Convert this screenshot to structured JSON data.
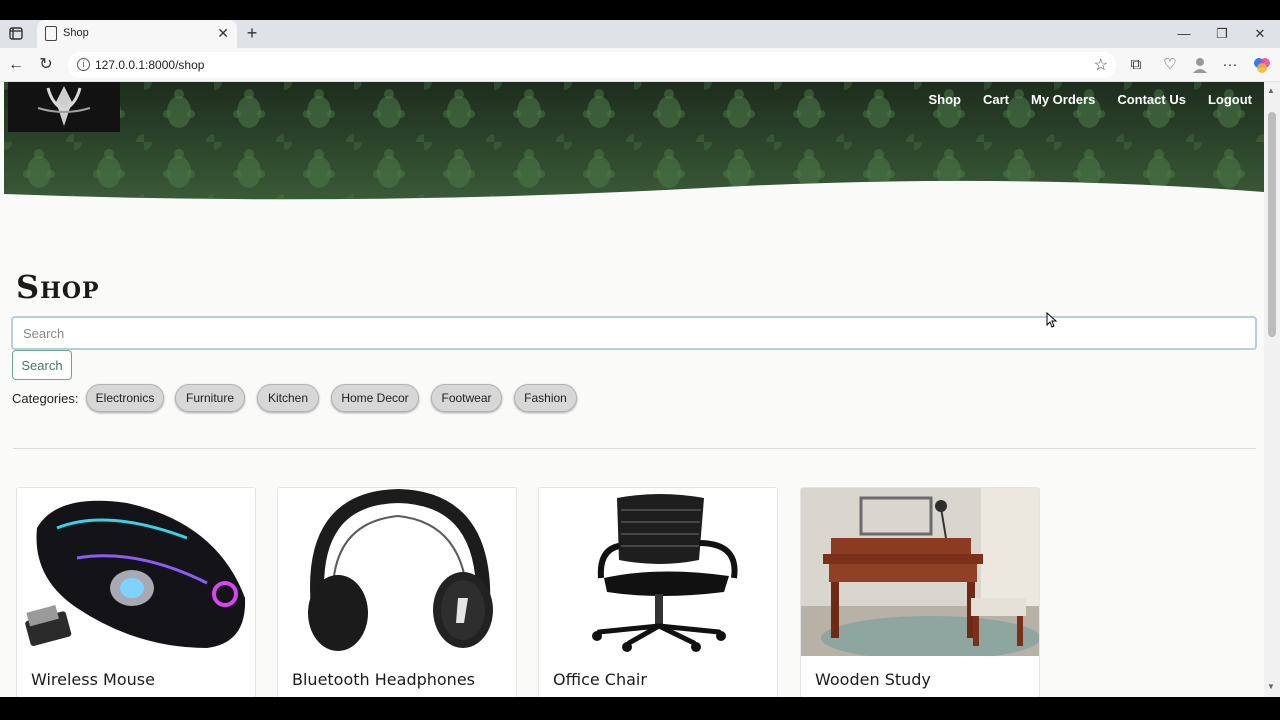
{
  "browser": {
    "tab_title": "Shop",
    "url": "127.0.0.1:8000/shop"
  },
  "nav": {
    "items": [
      "Shop",
      "Cart",
      "My Orders",
      "Contact Us",
      "Logout"
    ]
  },
  "page": {
    "heading": "Shop",
    "search_placeholder": "Search",
    "search_button": "Search",
    "categories_label": "Categories:",
    "categories": [
      "Electronics",
      "Furniture",
      "Kitchen",
      "Home Decor",
      "Footwear",
      "Fashion"
    ]
  },
  "products": [
    {
      "name": "Wireless Mouse",
      "icon": "gaming-mouse-image"
    },
    {
      "name": "Bluetooth Headphones",
      "icon": "headphones-image"
    },
    {
      "name": "Office Chair",
      "icon": "office-chair-image"
    },
    {
      "name": "Wooden Study",
      "icon": "study-desk-image"
    }
  ],
  "colors": {
    "hero_green": "#2f4a2f",
    "page_bg": "#fafbf8",
    "button_green": "#3e7a5e"
  }
}
